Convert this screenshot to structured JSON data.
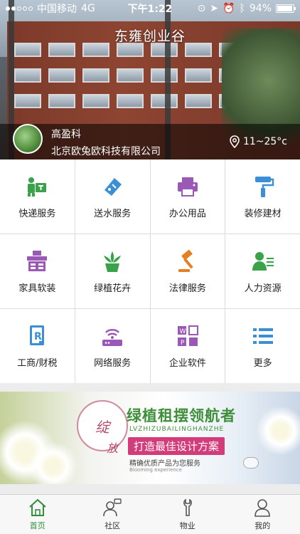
{
  "status_bar": {
    "carrier": "中国移动",
    "network": "4G",
    "time": "下午1:22",
    "battery": "94%",
    "battery_level": 0.94
  },
  "header": {
    "title": "东雍创业谷"
  },
  "user": {
    "name": "高盈科",
    "company": "北京欧兔欧科技有限公司",
    "weather": "11~25°c"
  },
  "services": [
    {
      "label": "快递服务",
      "icon": "delivery-icon",
      "color": "#3aa24a"
    },
    {
      "label": "送水服务",
      "icon": "water-ticket-icon",
      "color": "#3b8fd6"
    },
    {
      "label": "办公用品",
      "icon": "printer-icon",
      "color": "#9b59b6"
    },
    {
      "label": "装修建材",
      "icon": "paint-roller-icon",
      "color": "#3b8fd6"
    },
    {
      "label": "家具软装",
      "icon": "furniture-icon",
      "color": "#9b59b6"
    },
    {
      "label": "绿植花卉",
      "icon": "plant-icon",
      "color": "#3aa24a"
    },
    {
      "label": "法律服务",
      "icon": "gavel-icon",
      "color": "#e67e22"
    },
    {
      "label": "人力资源",
      "icon": "hr-icon",
      "color": "#3aa24a"
    },
    {
      "label": "工商/财税",
      "icon": "tax-document-icon",
      "color": "#3b8fd6"
    },
    {
      "label": "网络服务",
      "icon": "router-icon",
      "color": "#9b59b6"
    },
    {
      "label": "企业软件",
      "icon": "office-software-icon",
      "color": "#9b59b6"
    },
    {
      "label": "更多",
      "icon": "more-list-icon",
      "color": "#3b8fd6"
    }
  ],
  "banner": {
    "stamp_top": "绽",
    "stamp_bottom": "放",
    "title": "绿植租摆领航者",
    "pinyin": "LVZHIZUBAILINGHANZHE",
    "tag": "打造最佳设计方案",
    "subtitle": "精确优质产品为您服务",
    "subtitle_en": "Blooming experience"
  },
  "tabs": [
    {
      "label": "首页",
      "icon": "home-icon",
      "active": true
    },
    {
      "label": "社区",
      "icon": "community-icon",
      "active": false
    },
    {
      "label": "物业",
      "icon": "wrench-icon",
      "active": false
    },
    {
      "label": "我的",
      "icon": "profile-icon",
      "active": false
    }
  ]
}
